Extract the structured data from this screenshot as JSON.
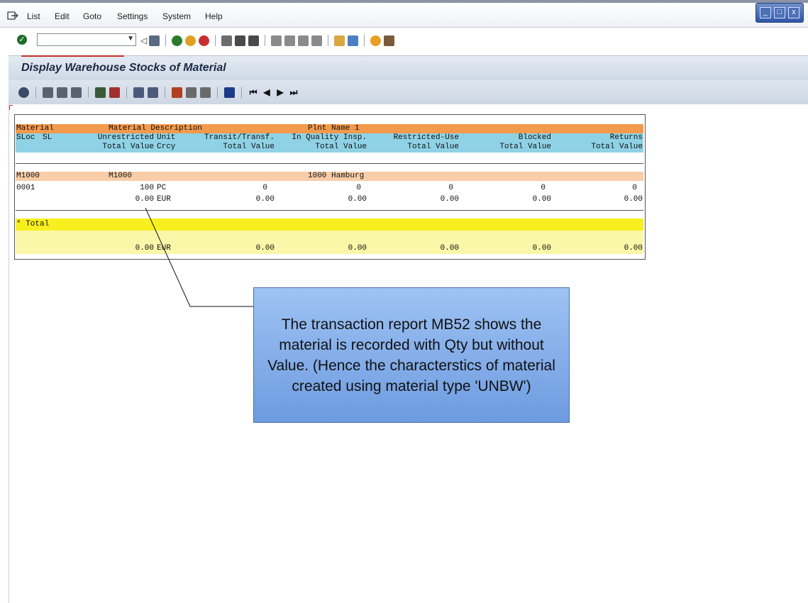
{
  "menu": {
    "items": [
      "List",
      "Edit",
      "Goto",
      "Settings",
      "System",
      "Help"
    ]
  },
  "window_controls": [
    "_",
    "□",
    "x"
  ],
  "title": "Display Warehouse Stocks of Material",
  "table": {
    "header1": {
      "material": "Material",
      "description": "Material Description",
      "plant_name": "Plnt Name 1"
    },
    "header2": {
      "sloc": "SLoc",
      "sl": "SL",
      "unrestricted": "Unrestricted",
      "unit": "Unit",
      "transit": "Transit/Transf.",
      "quality": "In Quality Insp.",
      "restricted": "Restricted-Use",
      "blocked": "Blocked",
      "returns": "Returns"
    },
    "header3": {
      "total_value": "Total Value",
      "crcy": "Crcy",
      "tv2": "Total Value",
      "tv3": "Total Value",
      "tv4": "Total Value",
      "tv5": "Total Value",
      "tv6": "Total Value"
    },
    "group": {
      "material": "M1000",
      "description": "M1000",
      "plant": "1000 Hamburg"
    },
    "row_qty": {
      "sloc": "0001",
      "unrestricted": "100",
      "unit": "PC",
      "transit": "0",
      "quality": "0",
      "restricted": "0",
      "blocked": "0",
      "returns": "0"
    },
    "row_val": {
      "unrestricted": "0.00",
      "crcy": "EUR",
      "transit": "0.00",
      "quality": "0.00",
      "restricted": "0.00",
      "blocked": "0.00",
      "returns": "0.00"
    },
    "total": {
      "label": "* Total",
      "unrestricted": "0.00",
      "crcy": "EUR",
      "transit": "0.00",
      "quality": "0.00",
      "restricted": "0.00",
      "blocked": "0.00",
      "returns": "0.00"
    }
  },
  "callout": {
    "text": "The transaction report MB52 shows the material is recorded with Qty but without Value. (Hence the characterstics of material created using material type 'UNBW')"
  },
  "colors": {
    "header_orange": "#f39a4d",
    "header_blue": "#8fd2e5",
    "group_peach": "#f9cda7",
    "total_yellow": "#f8f01e",
    "callout_blue": "#7fa9e8"
  }
}
